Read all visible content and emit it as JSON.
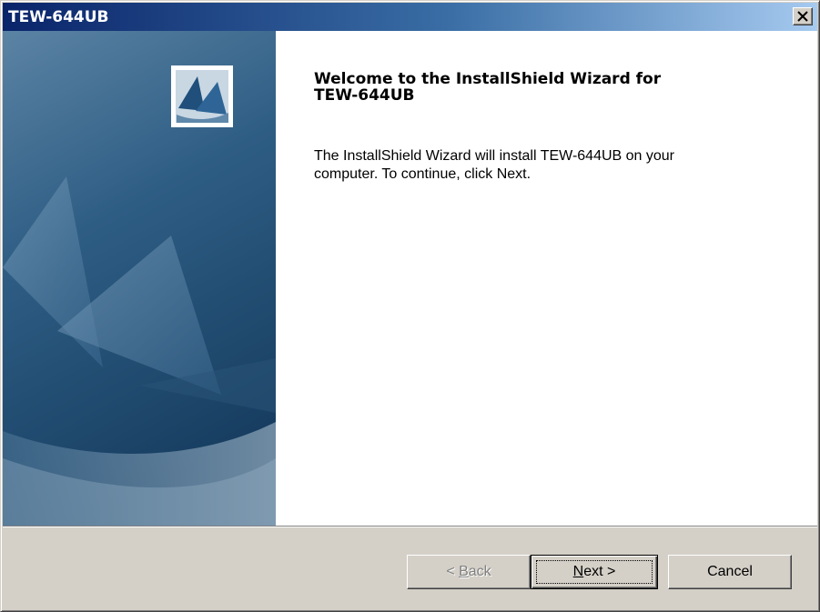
{
  "window": {
    "title": "TEW-644UB",
    "close_symbol": "×"
  },
  "colors": {
    "title_gradient_start": "#0a246a",
    "title_gradient_end": "#a6caf0",
    "panel_blue": "#2d5a80",
    "dialog_face": "#d4d0c8"
  },
  "main": {
    "heading_line1": "Welcome to the InstallShield Wizard for",
    "heading_line2": "TEW-644UB",
    "body_line1": "The InstallShield Wizard will install TEW-644UB  on your",
    "body_line2": "computer.  To continue, click Next."
  },
  "icons": {
    "logo": "installshield-sails-logo",
    "close": "close-icon"
  },
  "buttons": {
    "back_prefix": "< ",
    "back_mnemonic": "B",
    "back_rest": "ack",
    "next_mnemonic": "N",
    "next_rest": "ext >",
    "cancel": "Cancel"
  }
}
